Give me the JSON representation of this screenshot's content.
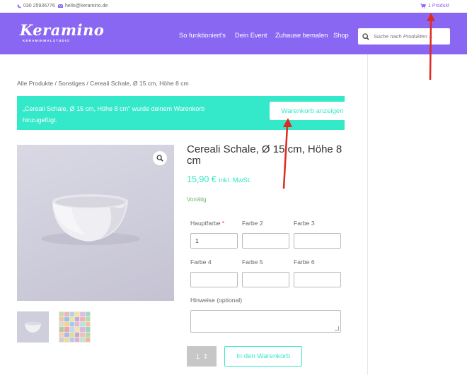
{
  "topbar": {
    "phone": "030 25936776",
    "email": "hello@keramino.de",
    "cart": "1 Produkt"
  },
  "header": {
    "logo": "Keramino",
    "logo_sub": "KERAMIKMALSTUDIO",
    "nav": [
      "So funktioniert's",
      "Dein Event",
      "Zuhause bemalen",
      "Shop"
    ],
    "search_placeholder": "Suche nach Produkten ..."
  },
  "breadcrumb": "Alle Produkte / Sonstiges / Cereali Schale, Ø 15 cm, Höhe 8 cm",
  "notice": {
    "text": "„Cereali Schale, Ø 15 cm, Höhe 8 cm“ wurde deinem Warenkorb hinzugefügt.",
    "button": "Warenkorb anzeigen"
  },
  "product": {
    "title": "Cereali Schale, Ø 15 cm, Höhe 8 cm",
    "price": "15,90 €",
    "tax_note": "inkl. MwSt.",
    "stock": "Vorrätig"
  },
  "form": {
    "fields": [
      {
        "label": "Hauptfarbe",
        "required": "*",
        "value": "1"
      },
      {
        "label": "Farbe 2",
        "value": ""
      },
      {
        "label": "Farbe 3",
        "value": ""
      },
      {
        "label": "Farbe 4",
        "value": ""
      },
      {
        "label": "Farbe 5",
        "value": ""
      },
      {
        "label": "Farbe 6",
        "value": ""
      }
    ],
    "notes_label": "Hinweise (optional)",
    "quantity": "1",
    "add_to_cart": "In den Warenkorb"
  },
  "colors": {
    "accent": "#8a67f3",
    "teal": "#33e9c9",
    "stock_green": "#68b56a",
    "arrow_red": "#e02a20"
  },
  "icons": [
    "phone-icon",
    "mail-icon",
    "cart-icon",
    "search-icon",
    "zoom-icon"
  ]
}
